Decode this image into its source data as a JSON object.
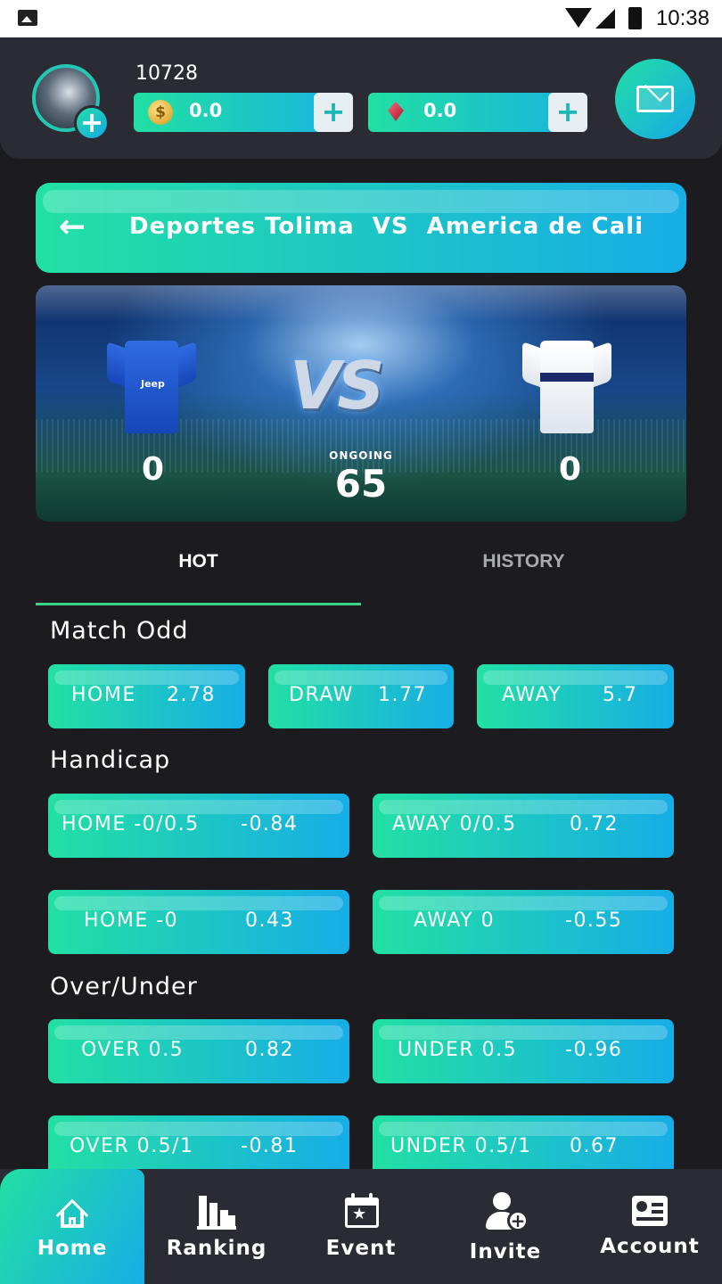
{
  "status_bar": {
    "time": "10:38"
  },
  "header": {
    "user_id": "10728",
    "coins": "0.0",
    "gems": "0.0",
    "plus": "+"
  },
  "match": {
    "back_arrow": "←",
    "title": "Deportes Tolima  VS  America de Cali",
    "home_score": "0",
    "away_score": "0",
    "status": "ONGOING",
    "minute": "65",
    "home_sponsor": "Jeep"
  },
  "tabs": {
    "hot": "HOT",
    "history": "HISTORY"
  },
  "sections": {
    "match_odd": "Match Odd",
    "handicap": "Handicap",
    "over_under": "Over/Under"
  },
  "match_odd": [
    {
      "label": "HOME",
      "value": "2.78"
    },
    {
      "label": "DRAW",
      "value": "1.77"
    },
    {
      "label": "AWAY",
      "value": "5.7"
    }
  ],
  "handicap": [
    {
      "label": "HOME -0/0.5",
      "value": "-0.84"
    },
    {
      "label": "AWAY 0/0.5",
      "value": "0.72"
    },
    {
      "label": "HOME -0",
      "value": "0.43"
    },
    {
      "label": "AWAY 0",
      "value": "-0.55"
    }
  ],
  "over_under": [
    {
      "label": "OVER 0.5",
      "value": "0.82"
    },
    {
      "label": "UNDER 0.5",
      "value": "-0.96"
    },
    {
      "label": "OVER 0.5/1",
      "value": "-0.81"
    },
    {
      "label": "UNDER 0.5/1",
      "value": "0.67"
    }
  ],
  "nav": {
    "home": "Home",
    "ranking": "Ranking",
    "event": "Event",
    "invite": "Invite",
    "account": "Account"
  },
  "colors": {
    "accent_start": "#22e0a3",
    "accent_end": "#17ade6",
    "background": "#1c1c20",
    "panel": "#2b2c33",
    "tab_indicator": "#3ed18a"
  }
}
